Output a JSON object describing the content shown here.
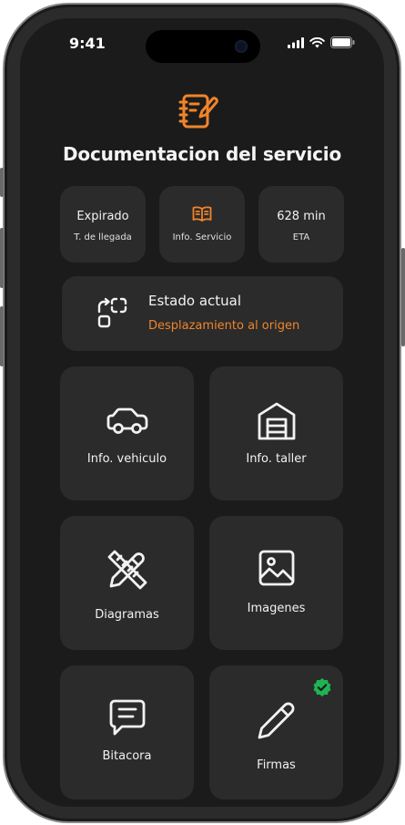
{
  "status_bar": {
    "time": "9:41"
  },
  "header": {
    "title": "Documentacion del servicio",
    "icon": "notebook-edit-icon"
  },
  "info_cards": [
    {
      "value": "Expirado",
      "label": "T. de llegada"
    },
    {
      "icon": "book-icon",
      "label": "Info. Servicio"
    },
    {
      "value": "628 min",
      "label": "ETA"
    }
  ],
  "estado": {
    "label": "Estado actual",
    "value": "Desplazamiento al origen"
  },
  "tiles": [
    {
      "label": "Info. vehiculo",
      "icon": "car-icon"
    },
    {
      "label": "Info. taller",
      "icon": "garage-icon"
    },
    {
      "label": "Diagramas",
      "icon": "pencil-ruler-icon"
    },
    {
      "label": "Imagenes",
      "icon": "image-icon"
    },
    {
      "label": "Bitacora",
      "icon": "message-icon"
    },
    {
      "label": "Firmas",
      "icon": "pencil-icon",
      "status": "completed"
    }
  ],
  "colors": {
    "accent": "#f0842a",
    "success": "#1fb356",
    "background": "#1b1b1b",
    "card": "#2b2b2b"
  }
}
